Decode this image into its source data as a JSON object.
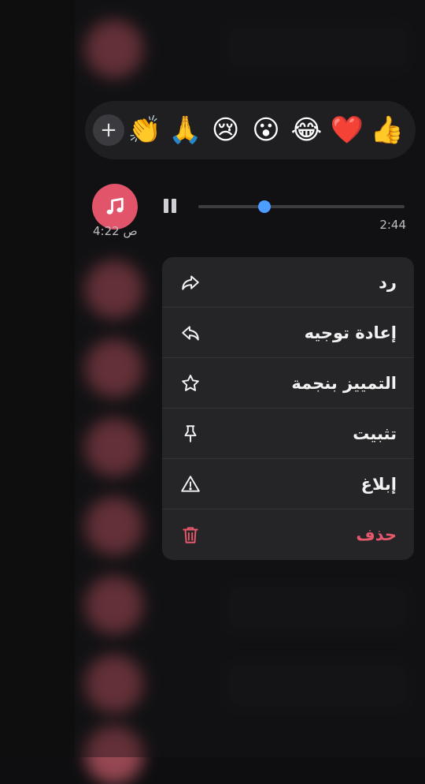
{
  "reactions": {
    "add_icon": "plus-icon",
    "emojis": [
      "👏",
      "🙏",
      "😢",
      "😮",
      "😂",
      "❤️",
      "👍"
    ]
  },
  "voice_message": {
    "time_sent": "4:22 ص",
    "duration": "2:44",
    "progress": 0.32,
    "accent": "#e1546a",
    "knob_color": "#4d9cff"
  },
  "menu": {
    "items": [
      {
        "label": "رد",
        "icon": "reply-icon"
      },
      {
        "label": "إعادة توجيه",
        "icon": "forward-icon"
      },
      {
        "label": "التمييز بنجمة",
        "icon": "star-icon"
      },
      {
        "label": "تثبيت",
        "icon": "pin-icon"
      },
      {
        "label": "إبلاغ",
        "icon": "warning-icon"
      },
      {
        "label": "حذف",
        "icon": "trash-icon",
        "color": "#e8586c"
      }
    ]
  }
}
